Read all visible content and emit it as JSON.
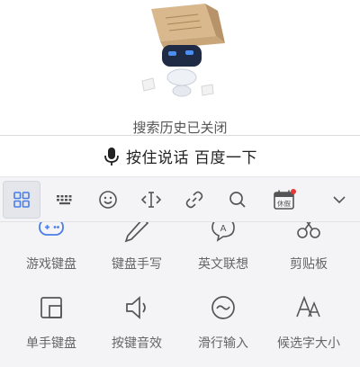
{
  "search_history": {
    "status_text": "搜索历史已关闭"
  },
  "voice_input": {
    "label": "按住说话 百度一下"
  },
  "toolbar": {
    "items": [
      {
        "name": "grid-icon",
        "active": true
      },
      {
        "name": "keyboard-icon",
        "active": false
      },
      {
        "name": "emoji-icon",
        "active": false
      },
      {
        "name": "cursor-move-icon",
        "active": false
      },
      {
        "name": "link-icon",
        "active": false
      },
      {
        "name": "search-icon",
        "active": false
      },
      {
        "name": "calendar-icon",
        "badge_text": "休假",
        "has_red_dot": true,
        "active": false
      },
      {
        "name": "chevron-down-icon",
        "active": false
      }
    ]
  },
  "panel": {
    "row1": [
      {
        "label": "游戏键盘",
        "icon": "gamepad-icon"
      },
      {
        "label": "键盘手写",
        "icon": "pen-icon"
      },
      {
        "label": "英文联想",
        "icon": "english-bubble-icon"
      },
      {
        "label": "剪贴板",
        "icon": "scissors-icon"
      }
    ],
    "row2": [
      {
        "label": "单手键盘",
        "icon": "one-hand-icon"
      },
      {
        "label": "按键音效",
        "icon": "speaker-icon"
      },
      {
        "label": "滑行输入",
        "icon": "swipe-icon"
      },
      {
        "label": "候选字大小",
        "icon": "font-size-icon"
      }
    ]
  },
  "colors": {
    "accent_blue": "#4a7de8",
    "badge_red": "#e53935",
    "icon_gray": "#555555"
  }
}
